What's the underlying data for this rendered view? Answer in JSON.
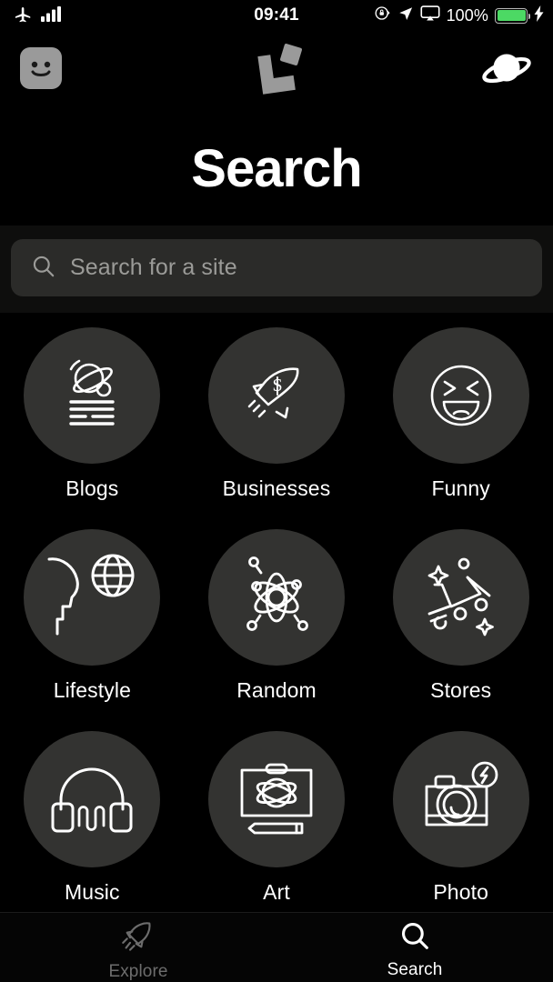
{
  "status_bar": {
    "airplane_icon": "airplane-icon",
    "signal_icon": "signal-bars-icon",
    "time": "09:41",
    "rotation_lock_icon": "rotation-lock-icon",
    "location_icon": "location-arrow-icon",
    "airplay_icon": "airplay-icon",
    "battery_percent": "100%",
    "battery_icon": "battery-icon",
    "charging_icon": "lightning-bolt-icon",
    "battery_color": "#4cd964"
  },
  "nav_bar": {
    "account_icon": "smiley-face-icon",
    "logo_icon": "blocks-logo-icon",
    "planet_icon": "planet-icon"
  },
  "header": {
    "title": "Search"
  },
  "search": {
    "icon": "search-icon",
    "placeholder": "Search for a site",
    "value": ""
  },
  "categories": [
    {
      "label": "Blogs",
      "icon": "planet-with-text-lines-icon"
    },
    {
      "label": "Businesses",
      "icon": "rocket-with-dollar-icon"
    },
    {
      "label": "Funny",
      "icon": "laughing-face-icon"
    },
    {
      "label": "Lifestyle",
      "icon": "head-profile-globe-icon"
    },
    {
      "label": "Random",
      "icon": "atom-icon"
    },
    {
      "label": "Stores",
      "icon": "flying-shopping-cart-icon"
    },
    {
      "label": "Music",
      "icon": "headphones-waveform-icon"
    },
    {
      "label": "Art",
      "icon": "canvas-pencil-icon"
    },
    {
      "label": "Photo",
      "icon": "camera-flash-icon"
    }
  ],
  "tab_bar": {
    "tabs": [
      {
        "label": "Explore",
        "icon": "rocket-icon",
        "active": false
      },
      {
        "label": "Search",
        "icon": "search-icon",
        "active": true
      }
    ]
  },
  "colors": {
    "background": "#000000",
    "disc": "#333331",
    "search_field": "#2b2b29",
    "text_primary": "#ffffff",
    "text_muted": "#9b9b98",
    "tab_inactive": "#6d6d6d"
  }
}
